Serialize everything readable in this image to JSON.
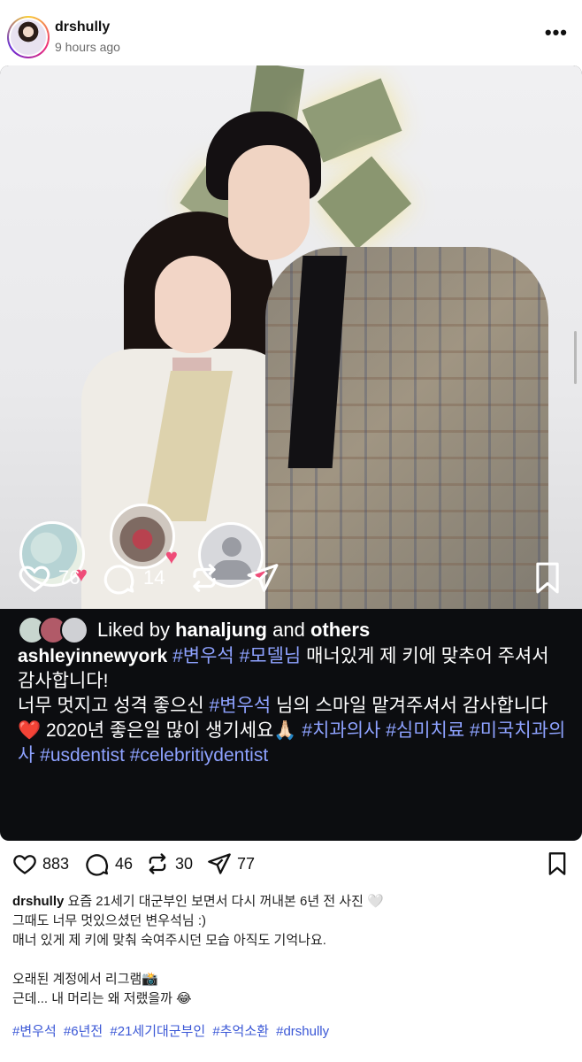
{
  "header": {
    "username": "drshully",
    "timestamp": "9 hours ago",
    "more_icon": "ellipsis-icon"
  },
  "repost": {
    "actions": {
      "likes": "76",
      "comments": "14"
    },
    "liked_by": {
      "prefix": "Liked by",
      "user": "hanaljung",
      "and": "and",
      "others": "others"
    },
    "caption": {
      "username": "ashleyinnewyork",
      "tag1": "#변우석",
      "tag2": "#모델님",
      "text1": "매너있게 제 키에 맞추어 주셔서 감사합니다!",
      "text2a": "너무 멋지고 성격 좋으신",
      "tag3": "#변우석",
      "text2b": "님의 스마일 맡겨주셔서 감사합니다",
      "heart": "❤️",
      "text3": "2020년 좋은일 많이 생기세요",
      "pray": "🙏🏻",
      "tag4": "#치과의사",
      "tag5": "#심미치료",
      "tag6": "#미국치과의사",
      "tag7": "#usdentist",
      "tag8": "#celebritiydentist"
    }
  },
  "post_actions": {
    "likes": "883",
    "comments": "46",
    "reposts": "30",
    "shares": "77"
  },
  "post_caption": {
    "username": "drshully",
    "line1": "요즘 21세기 대군부인 보면서 다시 꺼내본 6년 전 사진 🤍",
    "line2": "그때도 너무 멋있으셨던 변우석님 :)",
    "line3": "매너 있게 제 키에 맞춰 숙여주시던 모습 아직도 기억나요.",
    "line4": "",
    "line5": "오래된 계정에서 리그램📸",
    "line6": "근데... 내 머리는 왜 저랬을까 😂"
  },
  "hashtags": [
    "#변우석",
    "#6년전",
    "#21세기대군부인",
    "#추억소환",
    "#drshully"
  ]
}
